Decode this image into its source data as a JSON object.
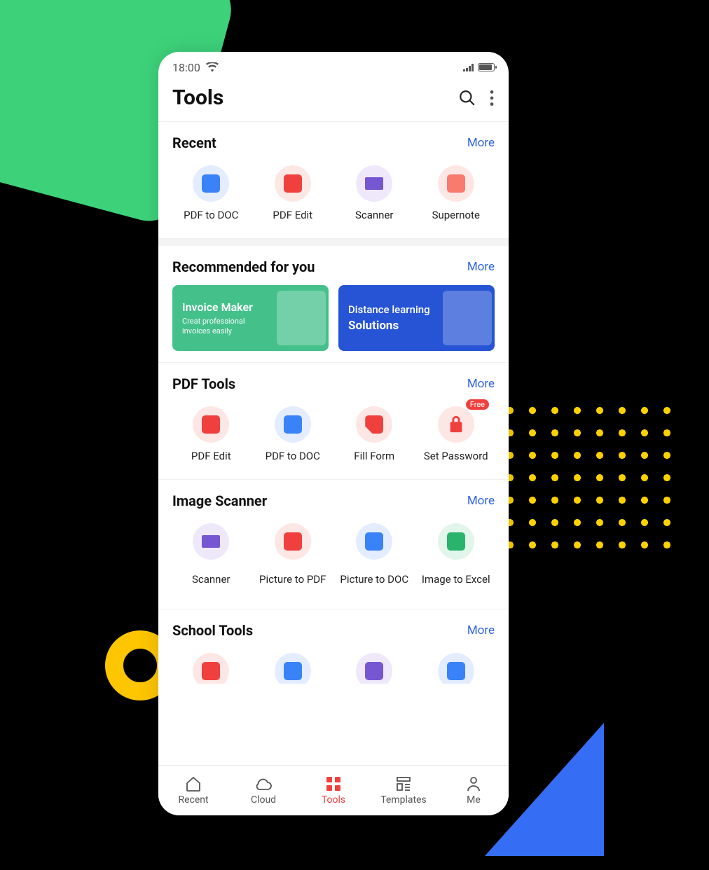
{
  "status": {
    "time": "18:00"
  },
  "header": {
    "title": "Tools"
  },
  "links": {
    "more": "More"
  },
  "sections": {
    "recent": {
      "title": "Recent",
      "items": [
        {
          "label": "PDF to DOC"
        },
        {
          "label": "PDF Edit"
        },
        {
          "label": "Scanner"
        },
        {
          "label": "Supernote"
        }
      ]
    },
    "recommended": {
      "title": "Recommended for you",
      "cards": [
        {
          "title": "Invoice Maker",
          "subtitle": "Creat professional invoices easily"
        },
        {
          "line1": "Distance learning",
          "line2": "Solutions"
        }
      ]
    },
    "pdf_tools": {
      "title": "PDF Tools",
      "items": [
        {
          "label": "PDF Edit"
        },
        {
          "label": "PDF to DOC"
        },
        {
          "label": "Fill Form"
        },
        {
          "label": "Set Password",
          "badge": "Free"
        }
      ]
    },
    "image_scanner": {
      "title": "Image Scanner",
      "items": [
        {
          "label": "Scanner"
        },
        {
          "label": "Picture to PDF"
        },
        {
          "label": "Picture to DOC"
        },
        {
          "label": "Image to Excel"
        }
      ]
    },
    "school_tools": {
      "title": "School Tools"
    }
  },
  "nav": {
    "items": [
      {
        "label": "Recent"
      },
      {
        "label": "Cloud"
      },
      {
        "label": "Tools"
      },
      {
        "label": "Templates"
      },
      {
        "label": "Me"
      }
    ],
    "active": "Tools"
  }
}
